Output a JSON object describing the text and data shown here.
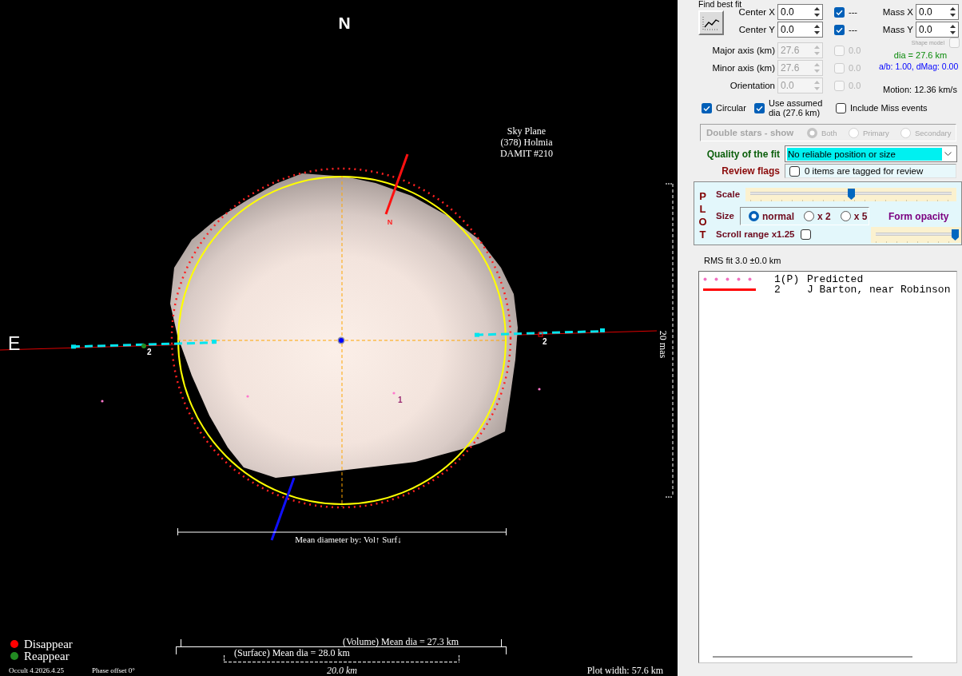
{
  "plot": {
    "north_label": "N",
    "east_label": "E",
    "title": [
      "Sky Plane",
      "(378) Holmia",
      "DAMIT #210"
    ],
    "pole_label": "N",
    "angular_scale": "20 mas",
    "chord_labels": [
      "2",
      "2"
    ],
    "point_label": "1",
    "diameter_caption": "Mean diameter by: Vol↑ Surf↓",
    "events": [
      {
        "label": "Disappear",
        "color": "#ff0000"
      },
      {
        "label": "Reappear",
        "color": "#228b22"
      }
    ],
    "volume_dia": "(Volume) Mean dia = 27.3 km",
    "surface_dia": "(Surface) Mean dia = 28.0 km",
    "scale_bar": "20.0 km",
    "version": "Occult 4.2026.4.25",
    "phase_offset": "Phase offset 0°",
    "plot_width": "Plot width: 57.6 km"
  },
  "fit": {
    "caption": "Find best fit",
    "params": [
      {
        "label": "Center X",
        "value": "0.0",
        "disabled": false,
        "checked": true,
        "note": "---"
      },
      {
        "label": "Center Y",
        "value": "0.0",
        "disabled": false,
        "checked": true,
        "note": "---"
      },
      {
        "label": "Major axis (km)",
        "value": "27.6",
        "disabled": true,
        "checked": false,
        "note": "0.0"
      },
      {
        "label": "Minor axis (km)",
        "value": "27.6",
        "disabled": true,
        "checked": false,
        "note": "0.0"
      },
      {
        "label": "Orientation",
        "value": "0.0",
        "disabled": true,
        "checked": false,
        "note": "0.0"
      }
    ],
    "mass": [
      {
        "label": "Mass X",
        "value": "0.0"
      },
      {
        "label": "Mass Y",
        "value": "0.0"
      }
    ],
    "shape_model": {
      "label": "Shape model",
      "checked": false,
      "disabled": true
    },
    "dia": "dia = 27.6 km",
    "ab_dmag": "a/b: 1.00, dMag: 0.00",
    "motion": "Motion: 12.36 km/s",
    "options": [
      {
        "label": "Circular",
        "checked": true
      },
      {
        "label": "Use assumed dia (27.6 km)",
        "checked": true
      },
      {
        "label": "Include Miss events",
        "checked": false
      }
    ]
  },
  "double_stars": {
    "label": "Double stars - show",
    "disabled": true,
    "options": [
      {
        "label": "Both",
        "selected": true
      },
      {
        "label": "Primary",
        "selected": false
      },
      {
        "label": "Secondary",
        "selected": false
      }
    ]
  },
  "quality": {
    "label": "Quality of the fit",
    "value": "No reliable position or size"
  },
  "review": {
    "label": "Review flags",
    "checked": false,
    "text": "0 items are tagged for review"
  },
  "plot_settings": {
    "title": "PLOT",
    "scale": {
      "label": "Scale",
      "level": 0.5
    },
    "size": {
      "label": "Size",
      "options": [
        {
          "label": "normal",
          "selected": true
        },
        {
          "label": "x 2",
          "selected": false
        },
        {
          "label": "x 5",
          "selected": false
        }
      ]
    },
    "form_opacity": {
      "label": "Form opacity",
      "level": 1.0
    },
    "scroll_range": {
      "label": "Scroll range x1.25",
      "checked": false
    }
  },
  "rms": "RMS fit 3.0 ±0.0 km",
  "observers": [
    {
      "kind": "dotted",
      "color": "#f070c0",
      "number": "1(P)",
      "name": "Predicted"
    },
    {
      "kind": "solid",
      "color": "#ff0000",
      "number": "2",
      "name": "J Barton, near Robinson"
    }
  ]
}
